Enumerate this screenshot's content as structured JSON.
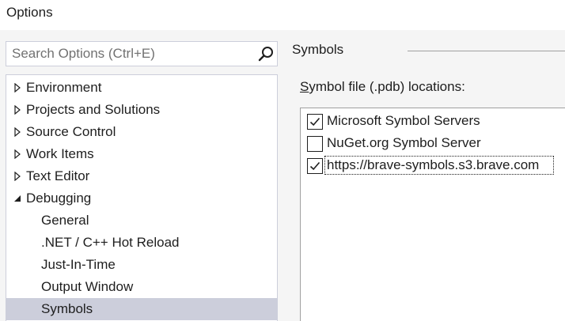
{
  "window": {
    "title": "Options"
  },
  "search": {
    "placeholder": "Search Options (Ctrl+E)"
  },
  "tree": {
    "items": [
      {
        "label": "Environment",
        "state": "collapsed"
      },
      {
        "label": "Projects and Solutions",
        "state": "collapsed"
      },
      {
        "label": "Source Control",
        "state": "collapsed"
      },
      {
        "label": "Work Items",
        "state": "collapsed"
      },
      {
        "label": "Text Editor",
        "state": "collapsed"
      },
      {
        "label": "Debugging",
        "state": "expanded"
      },
      {
        "label": "General",
        "state": "child"
      },
      {
        "label": ".NET / C++ Hot Reload",
        "state": "child"
      },
      {
        "label": "Just-In-Time",
        "state": "child"
      },
      {
        "label": "Output Window",
        "state": "child"
      },
      {
        "label": "Symbols",
        "state": "child-selected"
      }
    ]
  },
  "page": {
    "heading": "Symbols",
    "locations_label_accesskey": "S",
    "locations_label_rest": "ymbol file (.pdb) locations:"
  },
  "symbol_locations": [
    {
      "label": "Microsoft Symbol Servers",
      "checked": true
    },
    {
      "label": "NuGet.org Symbol Server",
      "checked": false
    },
    {
      "label": "https://brave-symbols.s3.brave.com",
      "checked": true
    }
  ],
  "colors": {
    "selection": "#cccedb",
    "border": "#cccedb",
    "background": "#f5f5f5"
  }
}
